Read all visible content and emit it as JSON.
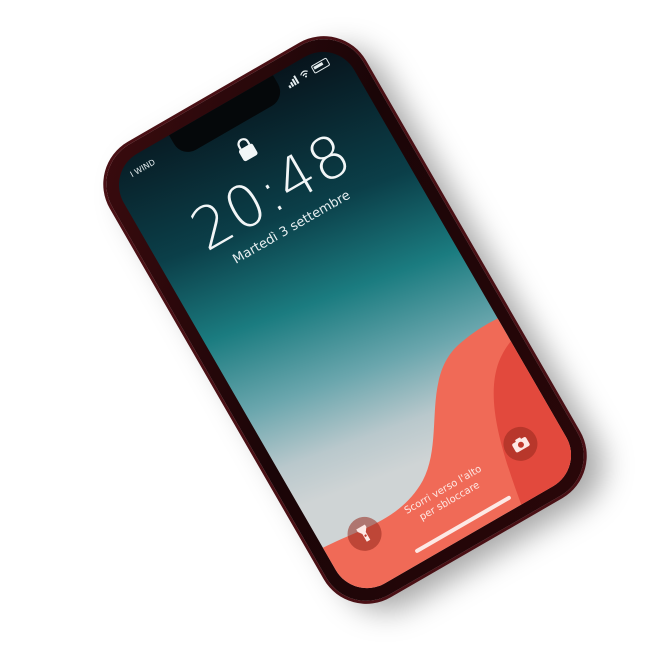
{
  "status_bar": {
    "carrier": "I WIND"
  },
  "lock_screen": {
    "time": "20:48",
    "date": "Martedì 3 settembre",
    "unlock_hint_line1": "Scorri verso l'alto",
    "unlock_hint_line2": "per sbloccare"
  },
  "icons": {
    "lock": "lock-icon",
    "flashlight": "flashlight-icon",
    "camera": "camera-icon",
    "signal": "signal-icon",
    "wifi": "wifi-icon",
    "battery": "battery-icon"
  },
  "colors": {
    "phone_body": "#2a0709",
    "wallpaper_top": "#07121a",
    "wallpaper_teal": "#1b7c80",
    "wallpaper_coral": "#f06a57",
    "wallpaper_coral_dark": "#e2493d"
  }
}
